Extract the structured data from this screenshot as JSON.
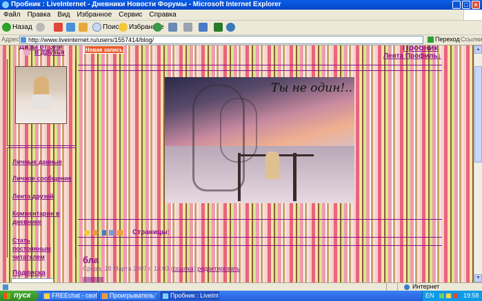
{
  "window": {
    "title": "Пробник : LiveInternet - Дневники Новости Форумы - Microsoft Internet Explorer",
    "minimize": "_",
    "maximize": "□",
    "close": "×"
  },
  "menu": [
    "Файл",
    "Правка",
    "Вид",
    "Избранное",
    "Сервис",
    "Справка"
  ],
  "toolbar": {
    "back": "Назад",
    "search": "Поиск",
    "favorites": "Избранное"
  },
  "address": {
    "label": "Адрес:",
    "url": "http://www.liveinternet.ru/users/1557414/blog/",
    "go": "Переход",
    "links": "Ссылки"
  },
  "page": {
    "top_left_title": "Дизы от Эли",
    "friends_link": "в друзья",
    "new_post": "Новая запись",
    "blog_name": "Пробник",
    "header_links": "Лента Профиль↓",
    "sidebar_links": [
      "Личные данные",
      "Личное сообщение",
      "Лента друзей",
      "Комментарии в дневнике",
      "Стать постоянным читателем"
    ],
    "subscribe": "Подписка",
    "banner_text": "Ты не один!..",
    "pages_label": "Страницы:",
    "post_title": "бла",
    "post_date": "Среда, 28 Марта 2007 г. 14:03",
    "post_link1": "ссылка",
    "post_link2": "редактировать"
  },
  "status": {
    "zone": "Интернет"
  },
  "taskbar": {
    "start": "пуск",
    "tasks": [
      "FREEchat - свобода ...",
      "Проигрыватель Win...",
      "Пробник : LiveIntern..."
    ],
    "lang": "EN",
    "clock": "19:58"
  },
  "colors": {
    "accent_link": "#8a0f8a",
    "xp_blue": "#0a5ee8",
    "start_green": "#3a9a2a"
  }
}
